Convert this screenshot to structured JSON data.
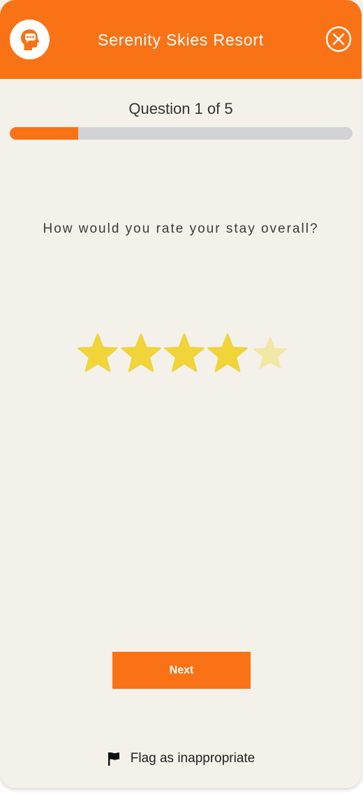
{
  "header": {
    "title": "Serenity Skies Resort",
    "brand_color": "#f97316",
    "logo_icon": "head-chat-icon",
    "close_icon": "close-circle-icon"
  },
  "progress": {
    "label": "Question 1 of 5",
    "current": 1,
    "total": 5,
    "fraction": 0.2
  },
  "question": {
    "text": "How would you rate your stay overall?"
  },
  "rating": {
    "max": 5,
    "value": 4,
    "filled_color": "#f0d43a",
    "empty_color": "#f3e7a4",
    "icon": "star-icon"
  },
  "actions": {
    "next_label": "Next",
    "flag_label": "Flag as inappropriate",
    "flag_icon": "flag-icon"
  }
}
